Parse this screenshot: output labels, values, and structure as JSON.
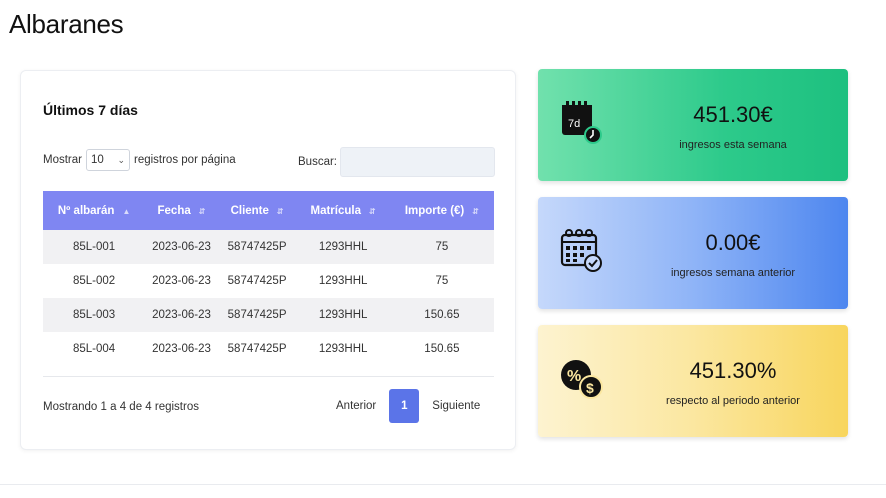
{
  "page": {
    "title": "Albaranes"
  },
  "table_card": {
    "title": "Últimos 7 días",
    "length": {
      "prefix": "Mostrar",
      "value": "10",
      "suffix": "registros por página"
    },
    "search": {
      "label": "Buscar:",
      "value": ""
    },
    "columns": [
      "Nº albarán",
      "Fecha",
      "Cliente",
      "Matrícula",
      "Importe (€)"
    ],
    "rows": [
      [
        "85L-001",
        "2023-06-23",
        "58747425P",
        "1293HHL",
        "75"
      ],
      [
        "85L-002",
        "2023-06-23",
        "58747425P",
        "1293HHL",
        "75"
      ],
      [
        "85L-003",
        "2023-06-23",
        "58747425P",
        "1293HHL",
        "150.65"
      ],
      [
        "85L-004",
        "2023-06-23",
        "58747425P",
        "1293HHL",
        "150.65"
      ]
    ],
    "info": "Mostrando 1 a 4 de 4 registros",
    "pager": {
      "prev": "Anterior",
      "current": "1",
      "next": "Siguiente"
    }
  },
  "stats": [
    {
      "value": "451.30€",
      "label": "ingresos esta semana",
      "icon": "calendar-7d-icon"
    },
    {
      "value": "0.00€",
      "label": "ingresos semana anterior",
      "icon": "calendar-check-icon"
    },
    {
      "value": "451.30%",
      "label": "respecto al periodo anterior",
      "icon": "percent-dollar-icon"
    }
  ],
  "colors": {
    "table_header": "#7f86f2",
    "active_page": "#5b74e8",
    "stat_green": "#2dca8b",
    "stat_blue": "#4d86ef",
    "stat_yellow": "#f8d55d"
  }
}
